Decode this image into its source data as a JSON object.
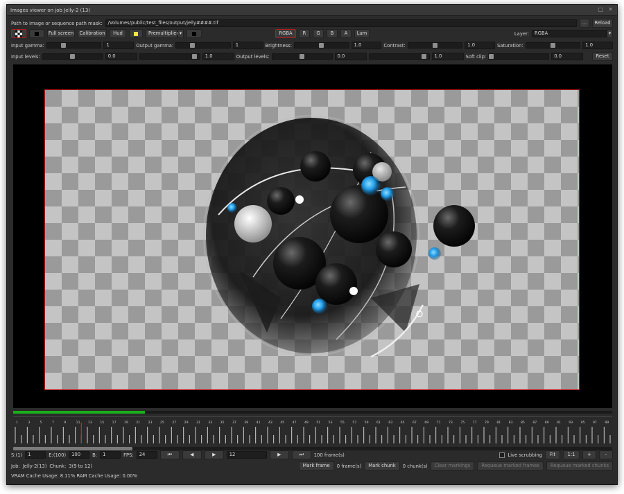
{
  "window": {
    "title": "Images viewer on job Jelly-2 (13)"
  },
  "path_row": {
    "label": "Path to image or sequence path mask:",
    "value": "/Volumes/public/test_files/output/jelly####.tif",
    "browse_label": "...",
    "reload_label": "Reload"
  },
  "toolbar": {
    "fullscreen_label": "Full screen",
    "calibration_label": "Calibration",
    "hud_label": "Hud",
    "premultiplied_label": "Premultiplied",
    "channels": [
      "RGBA",
      "R",
      "G",
      "B",
      "A",
      "Lum"
    ],
    "layer_label": "Layer:",
    "layer_value": "RGBA",
    "accent_color": "#ffe14a",
    "active_border_color": "#b31c1c"
  },
  "adjust_row": {
    "input_gamma_label": "Input gamma:",
    "input_gamma_value": "1",
    "input_gamma_pos": 0.28,
    "output_gamma_label": "Output gamma:",
    "output_gamma_value": "1",
    "output_gamma_pos": 0.28,
    "brightness_label": "Brightness:",
    "brightness_value": "1.0",
    "brightness_pos": 0.5,
    "contrast_label": "Contrast:",
    "contrast_value": "1.0",
    "contrast_pos": 0.5,
    "saturation_label": "Saturation:",
    "saturation_value": "1.0",
    "saturation_pos": 0.5
  },
  "levels_row": {
    "input_levels_label": "Input levels:",
    "input_low_value": "0.0",
    "input_low_pos": 0.5,
    "input_high_value": "1.0",
    "input_high_pos": 0.97,
    "output_levels_label": "Output levels:",
    "output_low_value": "0.0",
    "output_low_pos": 0.5,
    "output_high_value": "1.0",
    "output_high_pos": 0.97,
    "soft_clip_label": "Soft clip:",
    "soft_clip_value": "0.0",
    "soft_clip_pos": 0.0,
    "reset_label": "Reset"
  },
  "timeline": {
    "cache_progress": 0.22,
    "tick_labels": [
      "1",
      "3",
      "5",
      "7",
      "9",
      "11",
      "13",
      "15",
      "17",
      "19",
      "21",
      "23",
      "25",
      "27",
      "29",
      "31",
      "33",
      "35",
      "37",
      "39",
      "41",
      "43",
      "45",
      "47",
      "49",
      "51",
      "53",
      "55",
      "57",
      "59",
      "61",
      "63",
      "65",
      "67",
      "69",
      "71",
      "73",
      "75",
      "77",
      "79",
      "81",
      "83",
      "85",
      "87",
      "89",
      "91",
      "93",
      "95",
      "97",
      "99"
    ],
    "first_frame": 1,
    "last_frame": 100,
    "current_frame": 12,
    "playhead_color": "#e02020",
    "cache_color": "#1aae1a"
  },
  "controls": {
    "start_label": "S:(1)",
    "start_value": "1",
    "end_label": "E:(100)",
    "end_value": "100",
    "by_label": "B:",
    "by_value": "1",
    "fps_label": "FPS:",
    "fps_value": "24",
    "frame_value": "12",
    "frames_count": "100 frame(s)",
    "live_scrub_label": "Live scrubbing",
    "fit_label": "Fit",
    "one_to_one_label": "1:1",
    "zoom_in_label": "+",
    "zoom_out_label": "-"
  },
  "job_row": {
    "job_label": "Job:",
    "job_value": "Jelly-2(13)",
    "chunk_label": "Chunk:",
    "chunk_value": "3(9 to 12)",
    "mark_frame_label": "Mark frame",
    "frames_marked": "0 frame(s)",
    "mark_chunk_label": "Mark chunk",
    "chunks_marked": "0 chunk(s)",
    "clear_label": "Clear markings",
    "requeue_frames_label": "Requeue marked frames",
    "requeue_chunks_label": "Requeue marked chunks"
  },
  "status": {
    "cache_usage": "VRAM Cache Usage: 8.11% RAM Cache Usage: 0.00%"
  }
}
